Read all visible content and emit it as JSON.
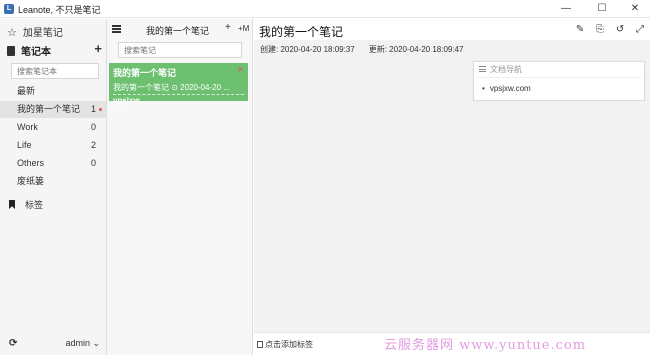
{
  "window": {
    "title": "Leanote, 不只是笔记",
    "logo": "L",
    "minimize": "—",
    "maximize": "☐",
    "close": "✕"
  },
  "sidebar": {
    "add_note": "加星笔记",
    "notebook_header": "笔记本",
    "add_notebook": "+",
    "search_placeholder": "搜索笔记本",
    "items": [
      {
        "label": "最新",
        "count": ""
      },
      {
        "label": "我的第一个笔记",
        "count": "1"
      },
      {
        "label": "Work",
        "count": "0"
      },
      {
        "label": "Life",
        "count": "2"
      },
      {
        "label": "Others",
        "count": "0"
      },
      {
        "label": "废纸篓",
        "count": ""
      }
    ],
    "tags_label": "标签",
    "sync_icon": "⟳",
    "user": "admin ⌄"
  },
  "notelist": {
    "title": "我的第一个笔记",
    "add": "+",
    "add_markdown": "+M",
    "search_placeholder": "搜索笔记",
    "note": {
      "title": "我的第一个笔记",
      "meta": "我的第一个笔记 ⊙ 2020-04-20 ...",
      "snippet": "vpsjxw",
      "delete": "✕"
    }
  },
  "editor": {
    "title": "我的第一个笔记",
    "tool_icons": [
      "✎",
      "⎘",
      "↺",
      "⤢"
    ],
    "created": "创建: 2020-04-20 18:09:37",
    "updated": "更新: 2020-04-20 18:09:47",
    "toc_title": "文档导航",
    "toc_items": [
      "vpsjxw.com"
    ],
    "tag_placeholder": "点击添加标签",
    "watermark": "云服务器网 www.yuntue.com"
  },
  "colors": {
    "accent": "#6cc070",
    "delete_dot": "#e25252",
    "watermark": "#e39be3"
  }
}
